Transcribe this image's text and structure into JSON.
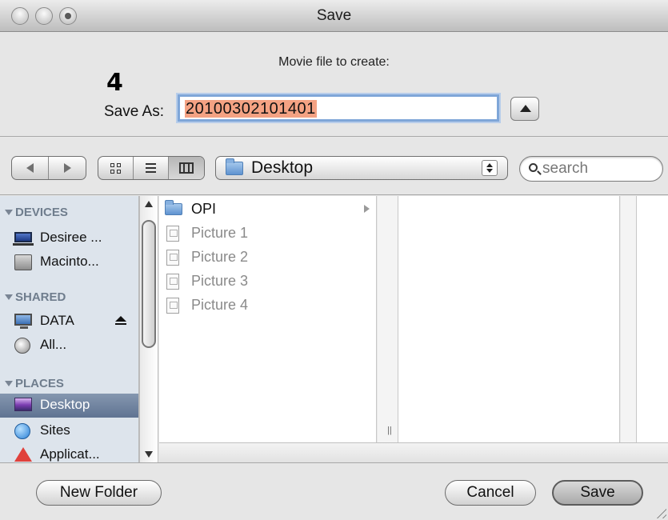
{
  "window": {
    "title": "Save"
  },
  "header": {
    "prompt": "Movie file to create:",
    "step_label": "4",
    "save_as_label": "Save As:",
    "save_as_value": "20100302101401"
  },
  "toolbar": {
    "location": "Desktop",
    "search_placeholder": "search",
    "view_modes": [
      "icon-view",
      "list-view",
      "column-view"
    ],
    "active_view": "column-view"
  },
  "sidebar": {
    "sections": [
      {
        "heading": "DEVICES",
        "items": [
          {
            "label": "Desiree ...",
            "icon": "laptop-icon"
          },
          {
            "label": "Macinto...",
            "icon": "hard-drive-icon"
          }
        ]
      },
      {
        "heading": "SHARED",
        "items": [
          {
            "label": "DATA",
            "icon": "monitor-icon",
            "eject": true
          },
          {
            "label": "All...",
            "icon": "network-icon"
          }
        ]
      },
      {
        "heading": "PLACES",
        "items": [
          {
            "label": "Desktop",
            "icon": "desktop-icon",
            "selected": true
          },
          {
            "label": "Sites",
            "icon": "globe-icon"
          },
          {
            "label": "Applicat...",
            "icon": "applications-icon"
          }
        ]
      }
    ]
  },
  "browser": {
    "column1": [
      {
        "name": "OPI",
        "kind": "folder",
        "has_children": true
      },
      {
        "name": "Picture 1",
        "kind": "file",
        "dimmed": true
      },
      {
        "name": "Picture 2",
        "kind": "file",
        "dimmed": true
      },
      {
        "name": "Picture 3",
        "kind": "file",
        "dimmed": true
      },
      {
        "name": "Picture 4",
        "kind": "file",
        "dimmed": true
      }
    ]
  },
  "buttons": {
    "new_folder": "New Folder",
    "cancel": "Cancel",
    "save": "Save"
  },
  "colors": {
    "selection_highlight": "#f4a283",
    "sidebar_bg": "#dde4ec",
    "sidebar_selected": "#6a7d99",
    "focus_ring": "#7fa6d8"
  }
}
